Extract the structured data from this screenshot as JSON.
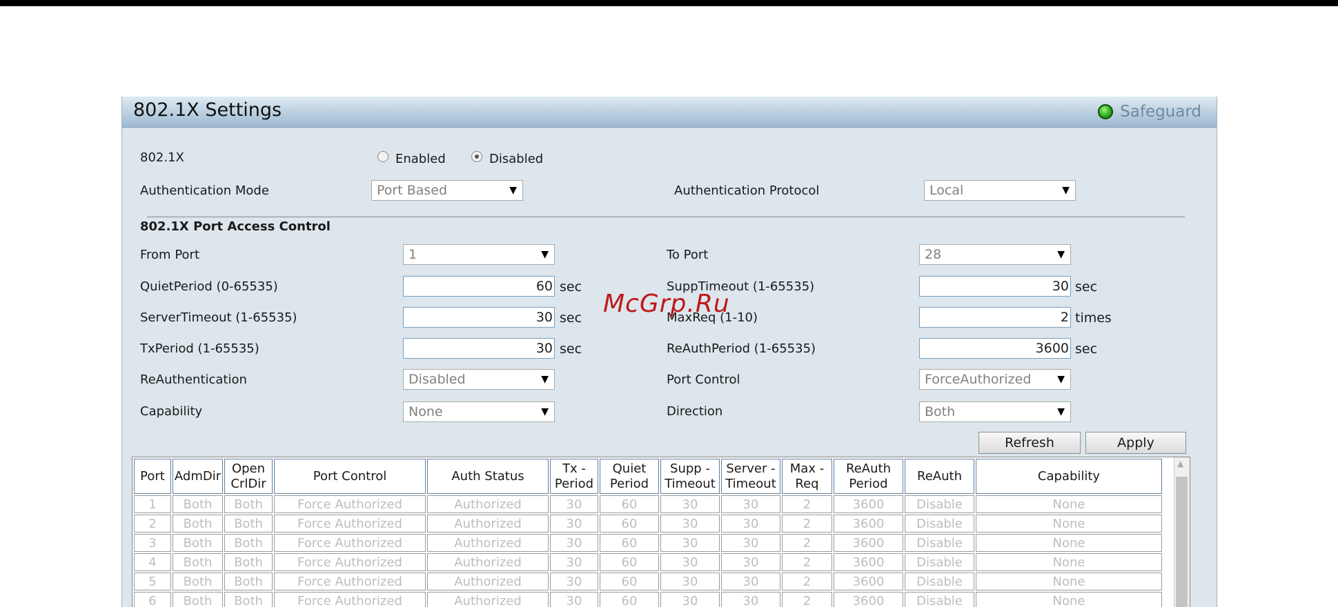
{
  "title": "802.1X Settings",
  "safeguard": "Safeguard",
  "dot1x": {
    "label": "802.1X",
    "enabled_label": "Enabled",
    "disabled_label": "Disabled",
    "selected": "Disabled"
  },
  "auth_mode": {
    "label": "Authentication Mode",
    "value": "Port Based"
  },
  "auth_protocol": {
    "label": "Authentication Protocol",
    "value": "Local"
  },
  "section_title": "802.1X Port Access Control",
  "form": {
    "from_port": {
      "label": "From Port",
      "value": "1"
    },
    "to_port": {
      "label": "To Port",
      "value": "28"
    },
    "quiet_period": {
      "label": "QuietPeriod (0-65535)",
      "value": "60",
      "unit": "sec"
    },
    "supp_timeout": {
      "label": "SuppTimeout (1-65535)",
      "value": "30",
      "unit": "sec"
    },
    "server_timeout": {
      "label": "ServerTimeout (1-65535)",
      "value": "30",
      "unit": "sec"
    },
    "max_req": {
      "label": "MaxReq (1-10)",
      "value": "2",
      "unit": "times"
    },
    "tx_period": {
      "label": "TxPeriod (1-65535)",
      "value": "30",
      "unit": "sec"
    },
    "reauth_period": {
      "label": "ReAuthPeriod (1-65535)",
      "value": "3600",
      "unit": "sec"
    },
    "reauthentication": {
      "label": "ReAuthentication",
      "value": "Disabled"
    },
    "port_control": {
      "label": "Port Control",
      "value": "ForceAuthorized"
    },
    "capability": {
      "label": "Capability",
      "value": "None"
    },
    "direction": {
      "label": "Direction",
      "value": "Both"
    }
  },
  "buttons": {
    "refresh": "Refresh",
    "apply": "Apply"
  },
  "table": {
    "headers": [
      "Port",
      "AdmDir",
      "Open CrlDir",
      "Port Control",
      "Auth Status",
      "Tx - Period",
      "Quiet Period",
      "Supp - Timeout",
      "Server - Timeout",
      "Max - Req",
      "ReAuth Period",
      "ReAuth",
      "Capability"
    ],
    "rows": [
      [
        "1",
        "Both",
        "Both",
        "Force Authorized",
        "Authorized",
        "30",
        "60",
        "30",
        "30",
        "2",
        "3600",
        "Disable",
        "None"
      ],
      [
        "2",
        "Both",
        "Both",
        "Force Authorized",
        "Authorized",
        "30",
        "60",
        "30",
        "30",
        "2",
        "3600",
        "Disable",
        "None"
      ],
      [
        "3",
        "Both",
        "Both",
        "Force Authorized",
        "Authorized",
        "30",
        "60",
        "30",
        "30",
        "2",
        "3600",
        "Disable",
        "None"
      ],
      [
        "4",
        "Both",
        "Both",
        "Force Authorized",
        "Authorized",
        "30",
        "60",
        "30",
        "30",
        "2",
        "3600",
        "Disable",
        "None"
      ],
      [
        "5",
        "Both",
        "Both",
        "Force Authorized",
        "Authorized",
        "30",
        "60",
        "30",
        "30",
        "2",
        "3600",
        "Disable",
        "None"
      ],
      [
        "6",
        "Both",
        "Both",
        "Force Authorized",
        "Authorized",
        "30",
        "60",
        "30",
        "30",
        "2",
        "3600",
        "Disable",
        "None"
      ]
    ]
  },
  "watermark": "McGrp.Ru"
}
